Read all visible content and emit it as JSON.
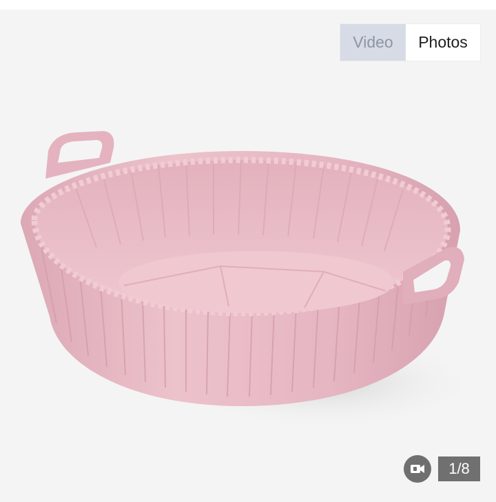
{
  "media_tabs": {
    "video_label": "Video",
    "photos_label": "Photos"
  },
  "gallery": {
    "counter": "1/8",
    "product_image": "pink silicone air fryer liner"
  },
  "icons": {
    "video_badge": "video-camera-icon"
  },
  "colors": {
    "liner_pink": "#e8bcc6",
    "active_tab_bg": "#ffffff",
    "inactive_tab_bg": "#d6dbe5",
    "counter_bg": "#707070"
  }
}
